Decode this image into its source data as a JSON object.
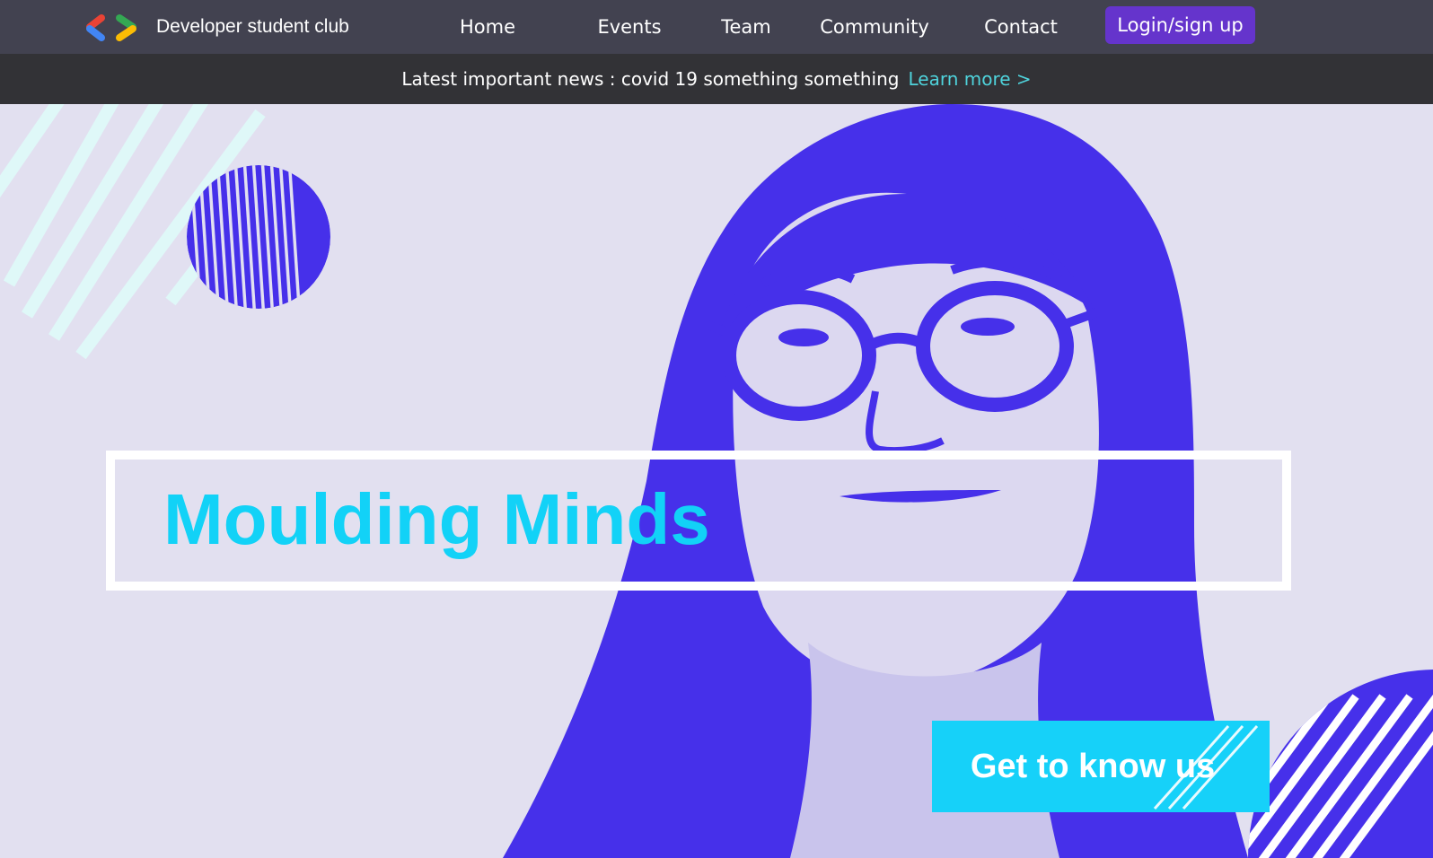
{
  "nav": {
    "brand": "Developer student club",
    "items": [
      {
        "label": "Home"
      },
      {
        "label": "Events"
      },
      {
        "label": "Team"
      },
      {
        "label": "Community"
      },
      {
        "label": "Contact"
      }
    ],
    "login_label": "Login/sign up",
    "logo_icon": "developer-brackets-icon"
  },
  "news": {
    "text": "Latest important news : covid 19 something something",
    "link": "Learn more >"
  },
  "hero": {
    "headline": "Moulding Minds",
    "cta_label": "Get to know us",
    "image": "woman-portrait-duotone"
  },
  "colors": {
    "nav_bg": "#424250",
    "news_bg": "#323236",
    "accent_purple": "#6534cc",
    "accent_cyan": "#16d1f9",
    "hero_bg": "#e2e0f0",
    "portrait_blue": "#4630ea"
  }
}
